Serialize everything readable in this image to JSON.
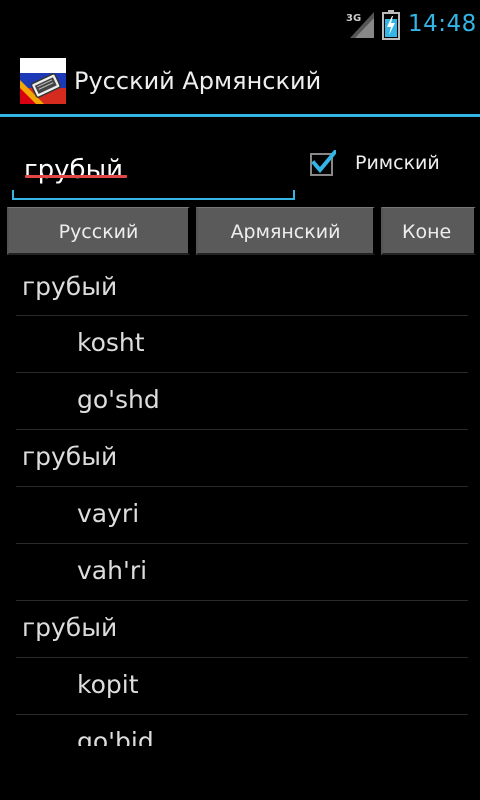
{
  "status_bar": {
    "network": "3G",
    "time": "14:48",
    "accent_color": "#33b5e5"
  },
  "action_bar": {
    "title": "Русский Армянский",
    "icon": "russia-armenia-flag-icon"
  },
  "search": {
    "value": "грубый",
    "placeholder": ""
  },
  "roman_checkbox": {
    "label": "Римский",
    "checked": true
  },
  "buttons": {
    "russian": "Русский",
    "armenian": "Армянский",
    "end": "Коне"
  },
  "results": [
    {
      "type": "word",
      "text": "грубый"
    },
    {
      "type": "translit",
      "text": "kosht"
    },
    {
      "type": "translit",
      "text": "go'shd"
    },
    {
      "type": "word",
      "text": "грубый"
    },
    {
      "type": "translit",
      "text": "vayri"
    },
    {
      "type": "translit",
      "text": "vah'ri"
    },
    {
      "type": "word",
      "text": "грубый"
    },
    {
      "type": "translit",
      "text": "kopit"
    },
    {
      "type": "translit",
      "text": "go'bid"
    }
  ]
}
